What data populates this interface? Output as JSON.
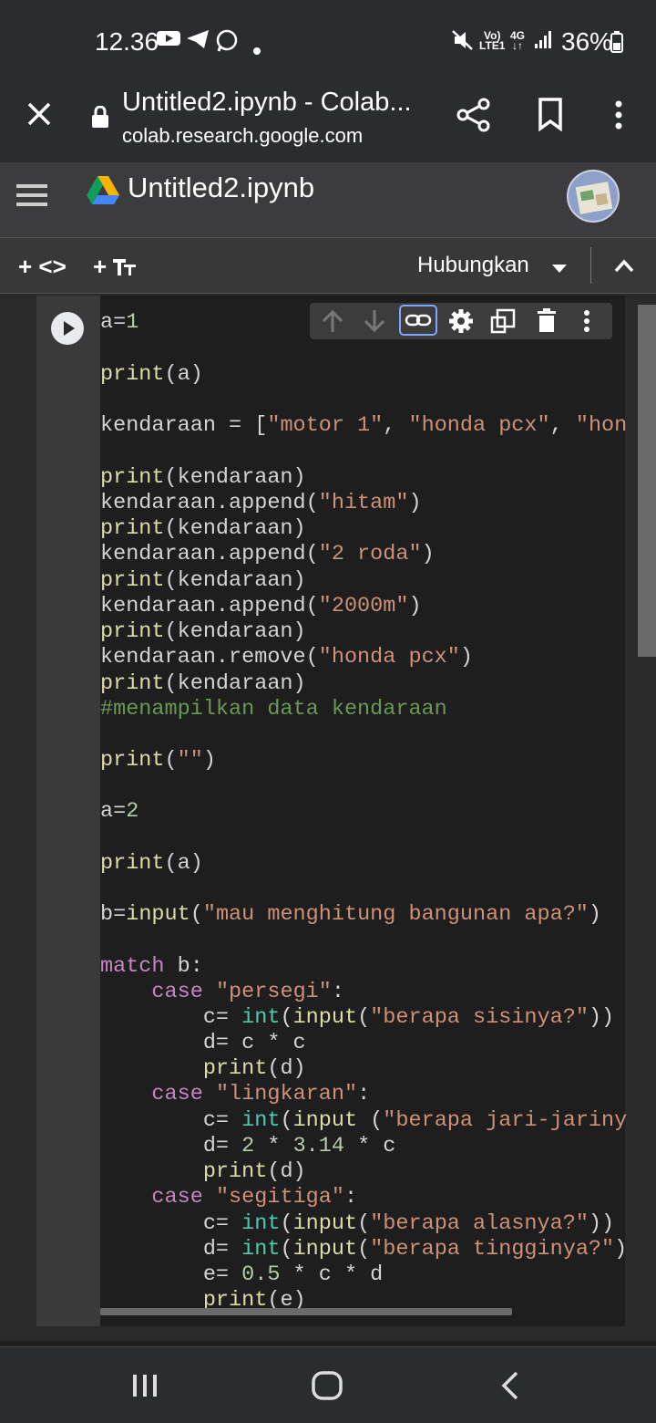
{
  "status_bar": {
    "time": "12.36",
    "net_top": "Vo)",
    "net_bottom": "LTE1",
    "net_type": "4G",
    "battery": "36%",
    "icons": [
      "youtube-icon",
      "telegram-icon",
      "whatsapp-icon",
      "dot-icon",
      "mute-icon",
      "signal-icon",
      "battery-icon"
    ]
  },
  "browser": {
    "title": "Untitled2.ipynb - Colab...",
    "url": "colab.research.google.com",
    "icons": [
      "close-icon",
      "lock-icon",
      "share-icon",
      "bookmark-icon",
      "more-vert-icon"
    ]
  },
  "colab_header": {
    "notebook_name": "Untitled2.ipynb",
    "icons": [
      "menu-icon",
      "google-drive-icon",
      "avatar"
    ]
  },
  "toolbar": {
    "add_code_label": "+ <>",
    "add_text_label": "+ ",
    "connect_label": "Hubungkan",
    "icons": [
      "chevron-down-icon",
      "chevron-up-icon"
    ]
  },
  "cell": {
    "toolbar_icons": [
      "move-up-icon",
      "move-down-icon",
      "link-icon",
      "gear-icon",
      "mirror-cell-icon",
      "delete-icon",
      "more-vert-icon"
    ],
    "code_lines": [
      "a=1",
      "",
      "print(a)",
      "",
      "kendaraan = [\"motor 1\", \"honda pcx\", \"hon",
      "",
      "print(kendaraan)",
      "kendaraan.append(\"hitam\")",
      "print(kendaraan)",
      "kendaraan.append(\"2 roda\")",
      "print(kendaraan)",
      "kendaraan.append(\"2000m\")",
      "print(kendaraan)",
      "kendaraan.remove(\"honda pcx\")",
      "print(kendaraan)",
      "#menampilkan data kendaraan",
      "",
      "print(\"\")",
      "",
      "a=2",
      "",
      "print(a)",
      "",
      "b=input(\"mau menghitung bangunan apa?\")",
      "",
      "match b:",
      "    case \"persegi\":",
      "        c= int(input(\"berapa sisinya?\"))",
      "        d= c * c",
      "        print(d)",
      "    case \"lingkaran\":",
      "        c= int(input (\"berapa jari-jariny",
      "        d= 2 * 3.14 * c",
      "        print(d)",
      "    case \"segitiga\":",
      "        c= int(input(\"berapa alasnya?\"))",
      "        d= int(input(\"berapa tingginya?\")",
      "        e= 0.5 * c * d",
      "        print(e)"
    ]
  },
  "nav_bar": {
    "icons": [
      "recent-apps-icon",
      "home-icon",
      "back-icon"
    ]
  }
}
